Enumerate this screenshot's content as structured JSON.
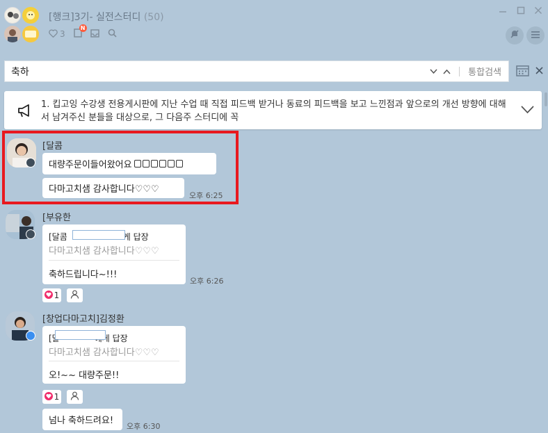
{
  "chat": {
    "title": "[행크]3기- 실전스터디",
    "member_count": "(50)",
    "likes_count": "3",
    "notification_badge": "N"
  },
  "search": {
    "query": "축하",
    "search_all_label": "통합검색"
  },
  "notice": {
    "text": "1. 킵고잉 수강생 전용게시판에 지난 수업 때 직접 피드백 받거나 동료의 피드백을 보고 느낀점과 앞으로의 개선 방향에 대해서 남겨주신 분들을 대상으로, 그 다음주 스터디에 꼭"
  },
  "messages": [
    {
      "sender": "[달콤",
      "bubbles": [
        "대량주문이들어왔어요",
        "다마고치샘 감사합니다♡♡♡"
      ],
      "time": "오후 6:25"
    },
    {
      "sender": "[부유한",
      "reply_head_prefix": "[달콤",
      "reply_head_suffix": "게 답장",
      "reply_quote": "다마고치샘 감사합니다♡♡♡",
      "reply_body": "축하드립니다~!!!",
      "time": "오후 6:26",
      "reaction_count": "1"
    },
    {
      "sender": "[창업다마고치]김정환",
      "reply_head_prefix": "[달",
      "reply_head_suffix": "에게 답장",
      "reply_quote": "다마고치샘 감사합니다♡♡♡",
      "reply_body": "오!~~ 대량주문!!",
      "reaction_count": "1",
      "extra_bubble": "넘나 축하드려요!",
      "time": "오후 6:30"
    }
  ],
  "colors": {
    "background": "#b2c7d9",
    "highlight": "#e8191f",
    "heart": "#f02d6b"
  }
}
